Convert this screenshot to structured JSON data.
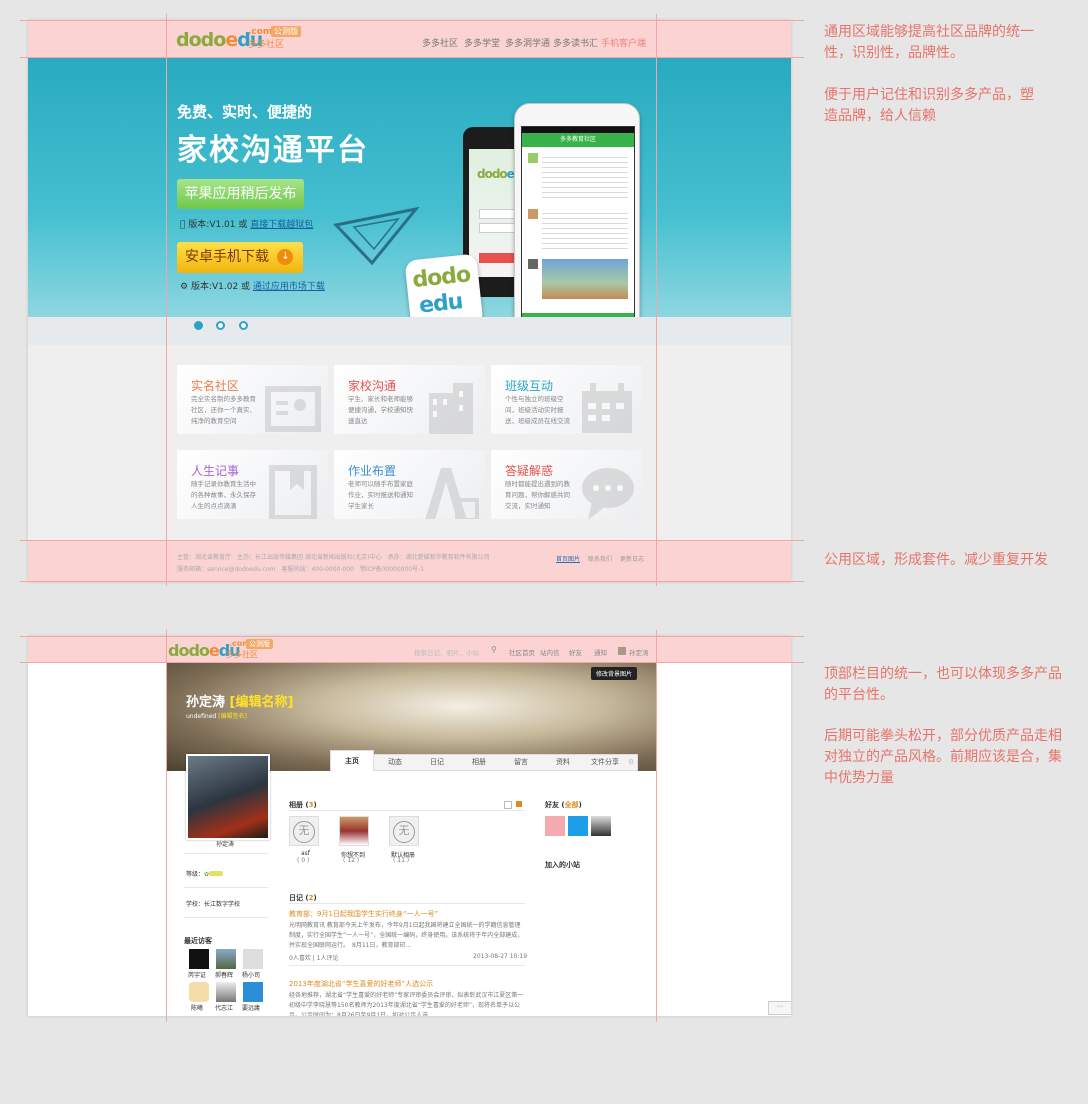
{
  "mock1": {
    "logo": {
      "d1": "dodo",
      "e": "e",
      "u": "du",
      "com": ".com",
      "sub": "多多社区",
      "tag": "公测版"
    },
    "nav": [
      "多多社区",
      "多多学堂",
      "多多洞学通",
      "多多读书汇",
      "手机客户端"
    ],
    "hero": {
      "subtitle": "免费、实时、便捷的",
      "title": "家校沟通平台",
      "ios_button": "苹果应用稍后发布",
      "ios_version": "版本:V1.01 或",
      "ios_link": "直接下载越狱包",
      "android_button": "安卓手机下载",
      "android_version": "版本:V1.02 或",
      "android_link": "通过应用市场下载",
      "phone_header": "多多教育社区",
      "app_logo_top": "dodo",
      "app_logo_bottom": "edu"
    },
    "cards": [
      {
        "title": "实名社区",
        "desc": "完全实名制的多多教育社区，还你一个真实、纯净的教育空间",
        "color": "#f07c4a"
      },
      {
        "title": "家校沟通",
        "desc": "学生、家长和老师能够便捷沟通，学校通知快速直达",
        "color": "#e9514f"
      },
      {
        "title": "班级互动",
        "desc": "个性与独立的班级空间，班级活动实时报送，班级成员在线交流",
        "color": "#2aa7c9"
      },
      {
        "title": "人生记事",
        "desc": "随手记录你教育生活中的各种故事，永久保存人生的点点滴滴",
        "color": "#a467d1"
      },
      {
        "title": "作业布置",
        "desc": "老师可以随手布置家庭作业，实时报送和通知学生家长",
        "color": "#3c8fd6"
      },
      {
        "title": "答疑解惑",
        "desc": "随时都能提出遇到的教育问题，帮你解惑共同交流，实时通知",
        "color": "#e9514f"
      }
    ],
    "footer": {
      "line1": "主管：湖北省教育厅　主办：长江出版传媒集团 湖北省新闻出版社(北京)中心　承办：湖北楚媒新华教育软件有限公司",
      "line2": "服务邮箱：service@dodoedu.com　客服热线：400-0000-000　鄂ICP备00000000号-1",
      "links": [
        "首页图片",
        "联系我们",
        "更新日志"
      ]
    }
  },
  "mock2": {
    "logo": {
      "d1": "dodo",
      "e": "e",
      "u": "du",
      "com": ".com",
      "sub": "多多社区",
      "tag": "公测版"
    },
    "search_placeholder": "搜索日记、相片、小站",
    "nav": [
      "社区首页",
      "站内信",
      "好友",
      "通知",
      "孙定涛"
    ],
    "cover_button": "修改背景图片",
    "name": "孙定涛",
    "name_edit": "[编辑名称]",
    "sign": "undefined",
    "sign_edit": "[编辑签名]",
    "tabs": [
      "主页",
      "动态",
      "日记",
      "相册",
      "留言",
      "资料",
      "文件分享"
    ],
    "avatar_name": "孙定涛",
    "level_label": "等级：",
    "school_label": "学校：",
    "school": "长江数字学校",
    "visitors_title": "最近访客",
    "visitors": [
      "芮宇证",
      "郝春辉",
      "杨小司",
      "陈曦",
      "代志江",
      "要远庸"
    ],
    "album_title": "相册",
    "album_count": "3",
    "albums": [
      {
        "name": "asf",
        "count": "( 0 )",
        "placeholder": "无"
      },
      {
        "name": "你想不到",
        "count": "( 12 )",
        "placeholder": ""
      },
      {
        "name": "默认相册",
        "count": "( 11 )",
        "placeholder": "无"
      }
    ],
    "friends_title": "好友",
    "friends_all": "全部",
    "stations_title": "加入的小站",
    "diary_title": "日记",
    "diary_count": "2",
    "posts": [
      {
        "title": "教育部：9月1日起我国学生实行终身“一人一号”",
        "body": "光明网教育讯 教育部今天上午发布，今年9月1日起我国将建立全国统一的学籍信息管理制度，实行全国学生“一人一号”，全国统一编码，终身使用。该系统将于年内全部建成，并实现全国联网运行。　8月11日，教育部印...",
        "meta": "0人喜欢 | 1人评论",
        "date": "2013-08-27 10:19"
      },
      {
        "title": "2013年度湖北省“学生喜爱的好老师”人选公示",
        "body": "经各地推荐，湖北省“学生喜爱的好老师”专家评审委员会评审，拟表彰武汉市江夏区第一初级中学李晓慧等150名教师为2013年度湖北省“学生喜爱的好老师”，现将名单予以公示。公示时间为：8月26日至9月1日，如对公示人选...",
        "meta": "",
        "date": ""
      }
    ]
  },
  "notes": {
    "n1_p1": "通用区域能够提高社区品牌的统一性，识别性，品牌性。",
    "n1_p2": "便于用户记住和识别多多产品，塑造品牌，给人信赖",
    "n2": "公用区域，形成套件。减少重复开发",
    "n3_p1": "顶部栏目的统一，也可以体现多多产品的平台性。",
    "n3_p2": "后期可能拳头松开，部分优质产品走相对独立的产品风格。前期应该是合，集中优势力量"
  },
  "colors": {
    "guide": "#f2a6a6",
    "band": "#fbd3d3",
    "note": "#e8736a",
    "hero": "#29aac0"
  }
}
